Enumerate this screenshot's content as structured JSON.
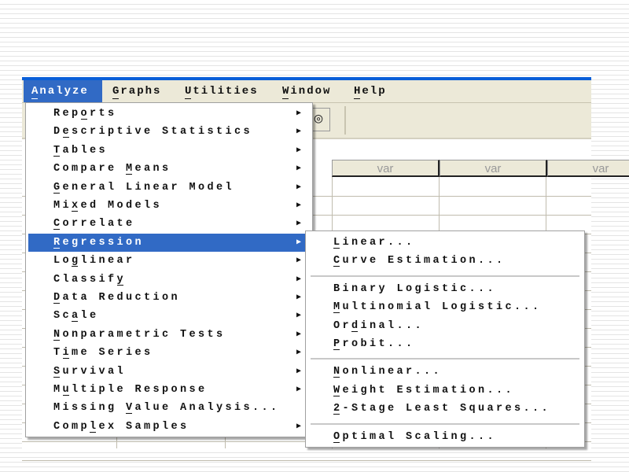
{
  "menubar": [
    {
      "label": "Analyze",
      "u": 0,
      "active": true
    },
    {
      "label": "Graphs",
      "u": 0
    },
    {
      "label": "Utilities",
      "u": 0
    },
    {
      "label": "Window",
      "u": 0
    },
    {
      "label": "Help",
      "u": 0
    }
  ],
  "grid": {
    "headers": [
      "var",
      "var",
      "var"
    ]
  },
  "analyze_menu": [
    {
      "label": "Reports",
      "u": 3,
      "submenu": true
    },
    {
      "label": "Descriptive Statistics",
      "u": 1,
      "submenu": true
    },
    {
      "label": "Tables",
      "u": 0,
      "submenu": true
    },
    {
      "label": "Compare Means",
      "u": 8,
      "submenu": true
    },
    {
      "label": "General Linear Model",
      "u": 0,
      "submenu": true
    },
    {
      "label": "Mixed Models",
      "u": 2,
      "submenu": true
    },
    {
      "label": "Correlate",
      "u": 0,
      "submenu": true
    },
    {
      "label": "Regression",
      "u": 0,
      "submenu": true,
      "selected": true
    },
    {
      "label": "Loglinear",
      "u": 2,
      "submenu": true
    },
    {
      "label": "Classify",
      "u": 7,
      "submenu": true
    },
    {
      "label": "Data Reduction",
      "u": 0,
      "submenu": true
    },
    {
      "label": "Scale",
      "u": 2,
      "submenu": true
    },
    {
      "label": "Nonparametric Tests",
      "u": 0,
      "submenu": true
    },
    {
      "label": "Time Series",
      "u": 1,
      "submenu": true
    },
    {
      "label": "Survival",
      "u": 0,
      "submenu": true
    },
    {
      "label": "Multiple Response",
      "u": 1,
      "submenu": true
    },
    {
      "label": "Missing Value Analysis...",
      "u": 8,
      "submenu": false
    },
    {
      "label": "Complex Samples",
      "u": 4,
      "submenu": true
    }
  ],
  "regression_submenu": [
    {
      "label": "Linear...",
      "u": 0
    },
    {
      "label": "Curve Estimation...",
      "u": 0
    },
    {
      "separator": true
    },
    {
      "label": "Binary Logistic...",
      "u": -1
    },
    {
      "label": "Multinomial Logistic...",
      "u": 0
    },
    {
      "label": "Ordinal...",
      "u": 2
    },
    {
      "label": "Probit...",
      "u": 0
    },
    {
      "separator": true
    },
    {
      "label": "Nonlinear...",
      "u": 0
    },
    {
      "label": "Weight Estimation...",
      "u": 0
    },
    {
      "label": "2-Stage Least Squares...",
      "u": 0
    },
    {
      "separator": true
    },
    {
      "label": "Optimal Scaling...",
      "u": 0
    }
  ],
  "colors": {
    "highlight": "#316ac5",
    "menubar_bg": "#ece9d8",
    "titlebar": "#0a5fd8"
  }
}
